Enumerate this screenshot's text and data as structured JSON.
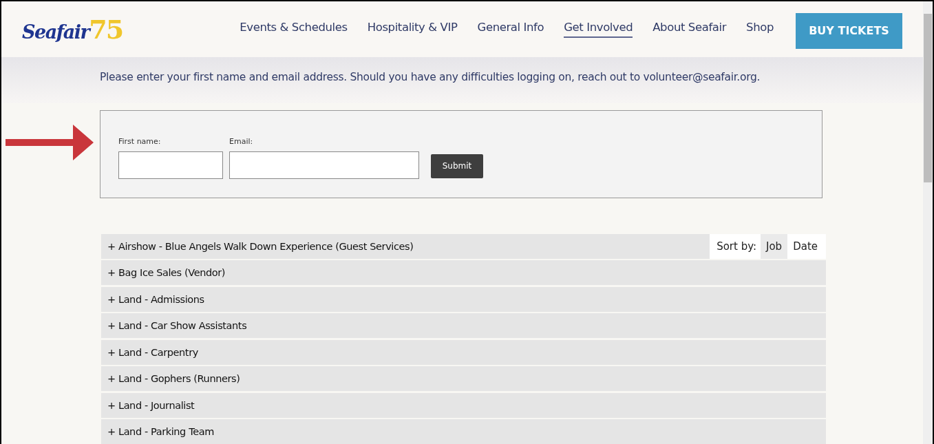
{
  "logo": {
    "name": "Seafair",
    "number": "75"
  },
  "nav": [
    {
      "label": "Events & Schedules",
      "selected": false
    },
    {
      "label": "Hospitality & VIP",
      "selected": false
    },
    {
      "label": "General Info",
      "selected": false
    },
    {
      "label": "Get Involved",
      "selected": true
    },
    {
      "label": "About Seafair",
      "selected": false
    },
    {
      "label": "Shop",
      "selected": false
    }
  ],
  "cta_button": "BUY TICKETS",
  "intro": "Please enter your first name and email address. Should you have any difficulties logging on, reach out to volunteer@seafair.org.",
  "login_form": {
    "fields": [
      {
        "label": "First name:",
        "kind": "short"
      },
      {
        "label": "Email:",
        "kind": "long"
      }
    ],
    "submit": "Submit"
  },
  "sort": {
    "label": "Sort by:",
    "options": [
      {
        "label": "Job",
        "selected": true
      },
      {
        "label": "Date",
        "selected": false
      }
    ]
  },
  "jobs": [
    "+ Airshow - Blue Angels Walk Down Experience (Guest Services)",
    "+ Bag Ice Sales (Vendor)",
    "+ Land - Admissions",
    "+ Land - Car Show Assistants",
    "+ Land - Carpentry",
    "+ Land - Gophers (Runners)",
    "+ Land - Journalist",
    "+ Land - Parking Team"
  ]
}
